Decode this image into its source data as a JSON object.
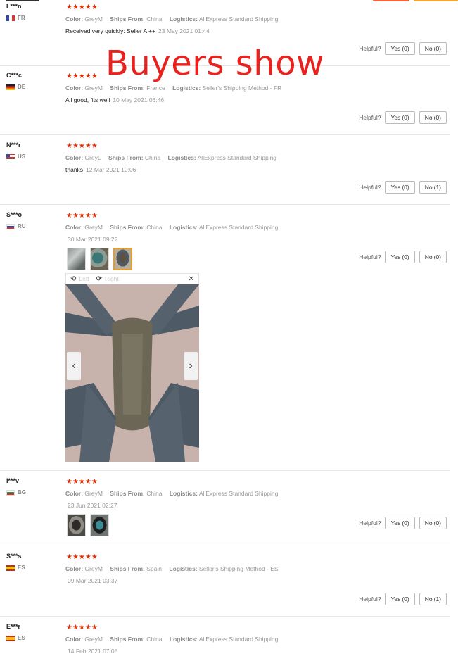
{
  "watermark": "Buyers show",
  "labels": {
    "color": "Color:",
    "ships_from": "Ships From:",
    "logistics": "Logistics:",
    "helpful": "Helpful?",
    "yes": "Yes",
    "no": "No"
  },
  "viewer": {
    "left_label": "Left",
    "right_label": "Right",
    "close_icon": "close-icon"
  },
  "reviews": [
    {
      "buyer": "L***n",
      "country": "FR",
      "rating": 5,
      "color": "GreyM",
      "ships_from": "China",
      "logistics": "AliExpress Standard Shipping",
      "text": "Received very quickly: Seller A ++",
      "date": "23 May 2021 01:44",
      "yes": "(0)",
      "no": "(0)"
    },
    {
      "buyer": "C***c",
      "country": "DE",
      "rating": 5,
      "color": "GreyM",
      "ships_from": "France",
      "logistics": "Seller's Shipping Method - FR",
      "text": "All good, fits well",
      "date": "10 May 2021 06:46",
      "yes": "(0)",
      "no": "(0)"
    },
    {
      "buyer": "N***r",
      "country": "US",
      "rating": 5,
      "color": "GreyL",
      "ships_from": "China",
      "logistics": "AliExpress Standard Shipping",
      "text": "thanks",
      "date": "12 Mar 2021 10:06",
      "yes": "(0)",
      "no": "(1)"
    },
    {
      "buyer": "S***o",
      "country": "RU",
      "rating": 5,
      "color": "GreyM",
      "ships_from": "China",
      "logistics": "AliExpress Standard Shipping",
      "text": "",
      "date": "30 Mar 2021 09:22",
      "yes": "(0)",
      "no": "(0)"
    },
    {
      "buyer": "I***v",
      "country": "BG",
      "rating": 5,
      "color": "GreyM",
      "ships_from": "China",
      "logistics": "AliExpress Standard Shipping",
      "text": "",
      "date": "23 Jun 2021 02:27",
      "yes": "(0)",
      "no": "(0)"
    },
    {
      "buyer": "S***s",
      "country": "ES",
      "rating": 5,
      "color": "GreyM",
      "ships_from": "Spain",
      "logistics": "Seller's Shipping Method - ES",
      "text": "",
      "date": "09 Mar 2021 03:37",
      "yes": "(0)",
      "no": "(1)"
    },
    {
      "buyer": "E***r",
      "country": "ES",
      "rating": 5,
      "color": "GreyM",
      "ships_from": "China",
      "logistics": "AliExpress Standard Shipping",
      "text": "",
      "date": "14 Feb 2021 07:05"
    }
  ],
  "colors": {
    "star": "#e62e04",
    "watermark": "#e8231f",
    "selected_thumb": "#e49c2a"
  }
}
